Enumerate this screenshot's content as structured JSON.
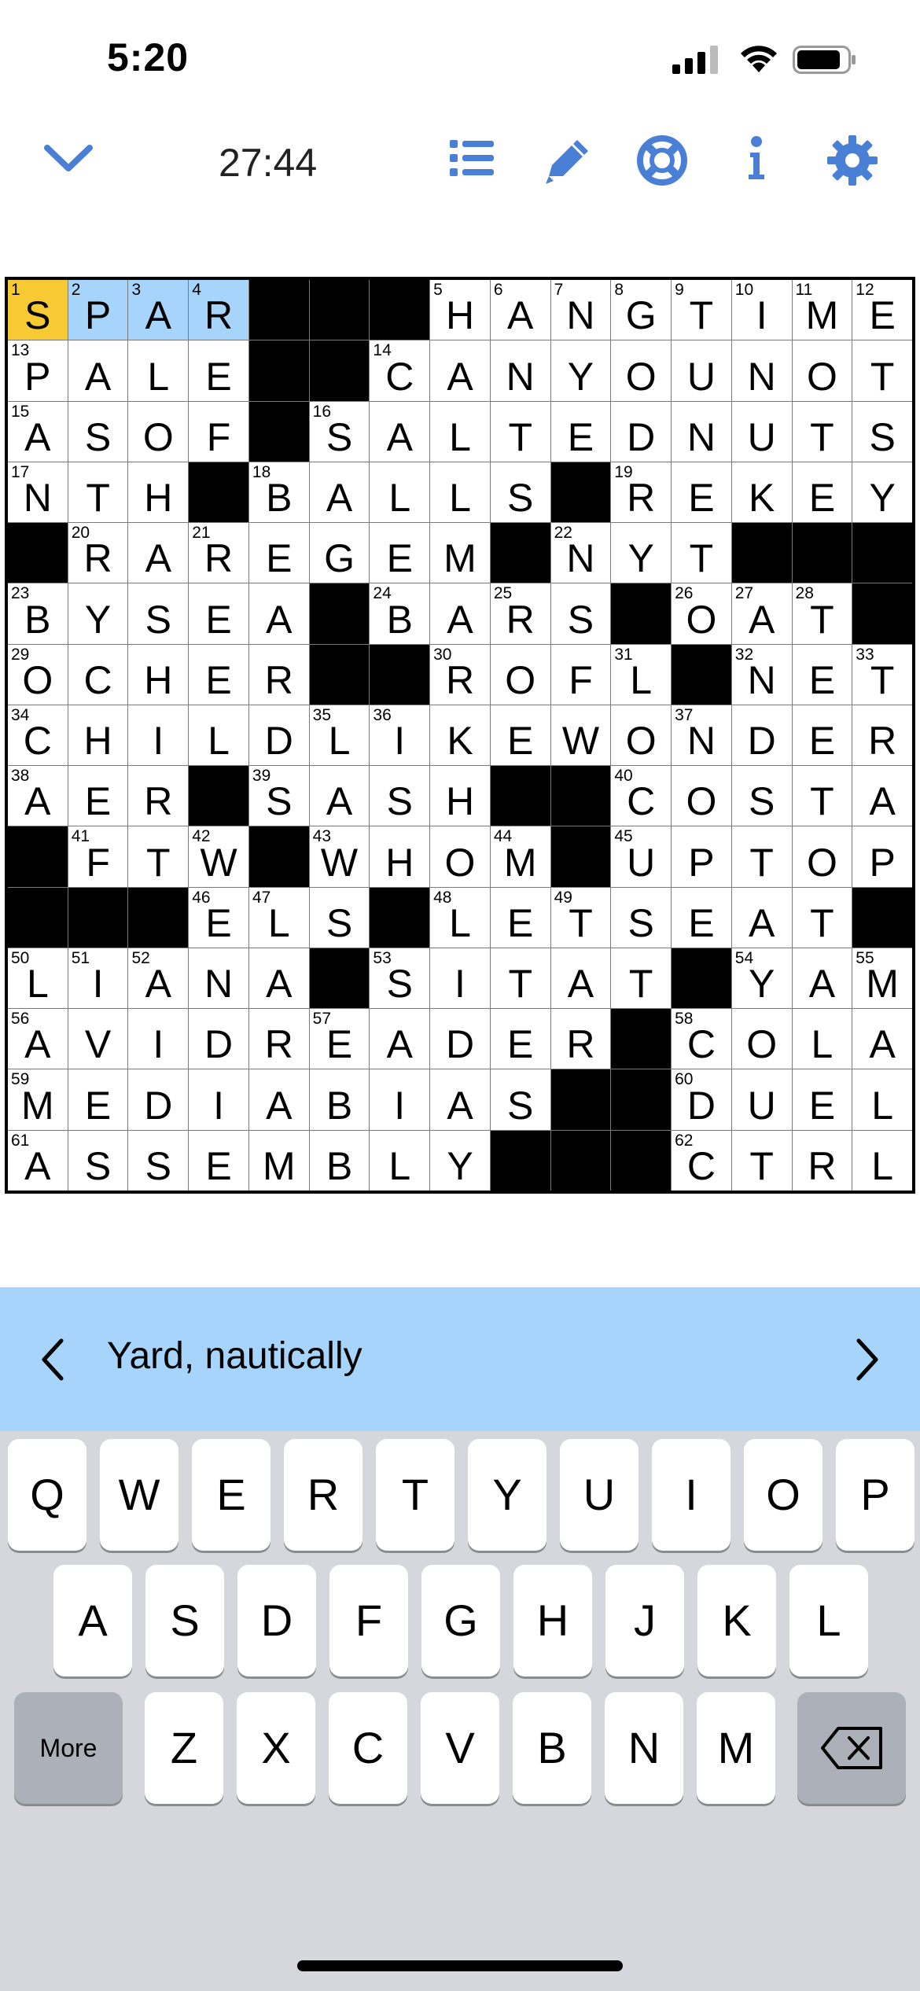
{
  "status": {
    "time": "5:20"
  },
  "toolbar": {
    "timer": "27:44",
    "icons": [
      "chevron-down-icon",
      "list-icon",
      "pencil-icon",
      "lifebuoy-icon",
      "info-icon",
      "gear-icon"
    ],
    "accent": "#4a7fd6"
  },
  "grid": {
    "size": 15,
    "rows": [
      "SPAR###HANGTIME",
      "PALE##CANYOUNOT",
      "ASOF#SALTEDNUTS",
      "NTH#BALLS#REKEY",
      "#RAREGEM#NYT###",
      "BYSEA#BARS#OAT#",
      "OCHER##ROFL#NET",
      "CHILDLIKEWONDER",
      "AER#SASH##COSTA",
      "#FTW#WHOM#UPTOP",
      "###ELS#LETSEAT#",
      "LIANA#SITAT#YAM",
      "AVIDREADER#COLA",
      "MEDIABIAS##DUEL",
      "ASSEMBLY###CTRL"
    ],
    "current_cell": [
      0,
      0
    ],
    "highlight_word": [
      [
        0,
        0
      ],
      [
        0,
        1
      ],
      [
        0,
        2
      ],
      [
        0,
        3
      ]
    ],
    "colors": {
      "current": "#f7c932",
      "word": "#a6d4fa",
      "black": "#000000"
    }
  },
  "clue": {
    "text": "Yard, nautically"
  },
  "keyboard": {
    "row1": [
      "Q",
      "W",
      "E",
      "R",
      "T",
      "Y",
      "U",
      "I",
      "O",
      "P"
    ],
    "row2": [
      "A",
      "S",
      "D",
      "F",
      "G",
      "H",
      "J",
      "K",
      "L"
    ],
    "more_label": "More",
    "row3": [
      "Z",
      "X",
      "C",
      "V",
      "B",
      "N",
      "M"
    ],
    "delete_icon": "backspace-icon"
  }
}
